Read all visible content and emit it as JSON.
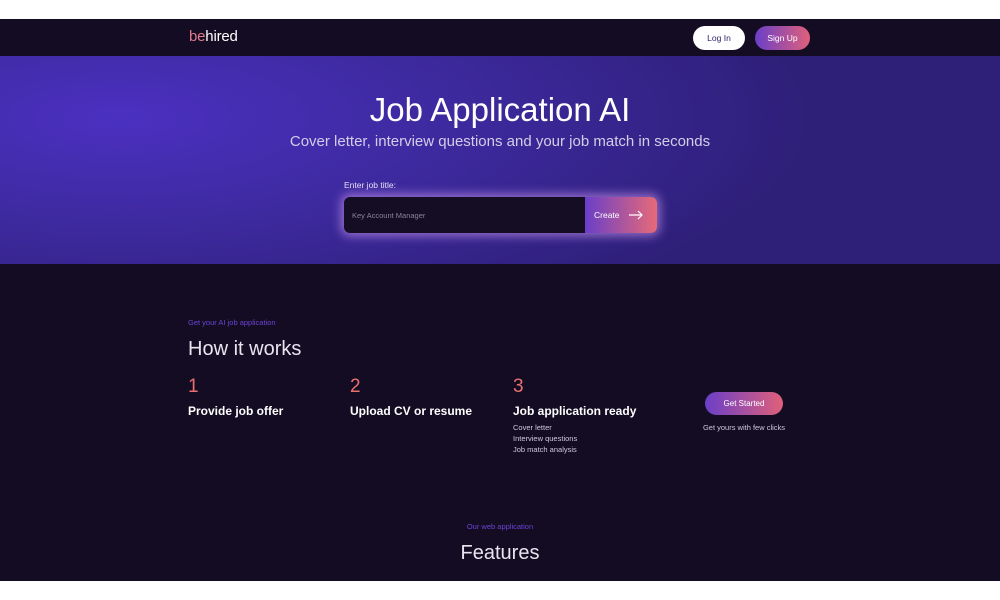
{
  "nav": {
    "logo_part1": "be",
    "logo_part2": "hired",
    "login_label": "Log In",
    "signup_label": "Sign Up"
  },
  "hero": {
    "title": "Job Application AI",
    "subtitle": "Cover letter, interview questions and your job match in seconds",
    "input_label": "Enter job title:",
    "input_placeholder": "Key Account Manager",
    "input_value": "",
    "create_label": "Create"
  },
  "how_it_works": {
    "eyebrow": "Get your AI job application",
    "title": "How it works",
    "steps": [
      {
        "number": "1",
        "title": "Provide job offer",
        "items": []
      },
      {
        "number": "2",
        "title": "Upload CV or resume",
        "items": []
      },
      {
        "number": "3",
        "title": "Job application ready",
        "items": [
          "Cover letter",
          "Interview questions",
          "Job match analysis"
        ]
      }
    ],
    "cta_label": "Get Started",
    "cta_caption": "Get yours with few clicks"
  },
  "features": {
    "eyebrow": "Our web application",
    "title": "Features"
  },
  "colors": {
    "background": "#140c22",
    "accent_purple": "#6a3fc8",
    "accent_coral": "#e9706e",
    "hero": "#3e2aa0"
  }
}
